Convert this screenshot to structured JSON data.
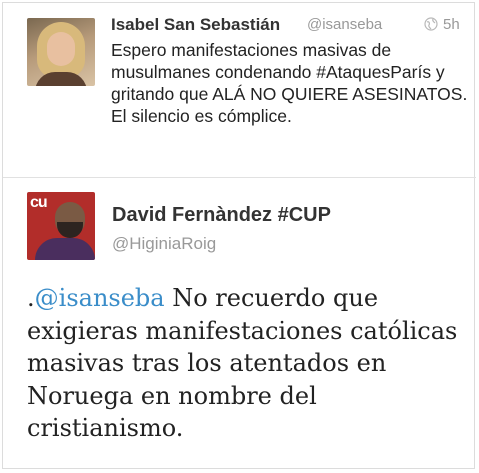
{
  "tweets": [
    {
      "author_name": "Isabel San Sebastián",
      "handle": "@isanseba",
      "time": "5h",
      "text": "Espero manifestaciones masivas de musulmanes condenando #AtaquesParís y gritando que ALÁ NO QUIERE ASESINATOS. El silencio es cómplice."
    },
    {
      "author_name": "David Fernàndez #CUP",
      "handle": "@HiginiaRoig",
      "text_prefix": ".",
      "mention": "@isanseba",
      "text": " No recuerdo que exigieras manifestaciones católicas masivas tras los atentados en Noruega en nombre del cristianismo.",
      "avatar_label": "cu"
    }
  ],
  "icons": {
    "visibility": "globe-icon"
  },
  "colors": {
    "mention": "#3a8dc9",
    "meta": "#999999",
    "text": "#222222"
  }
}
